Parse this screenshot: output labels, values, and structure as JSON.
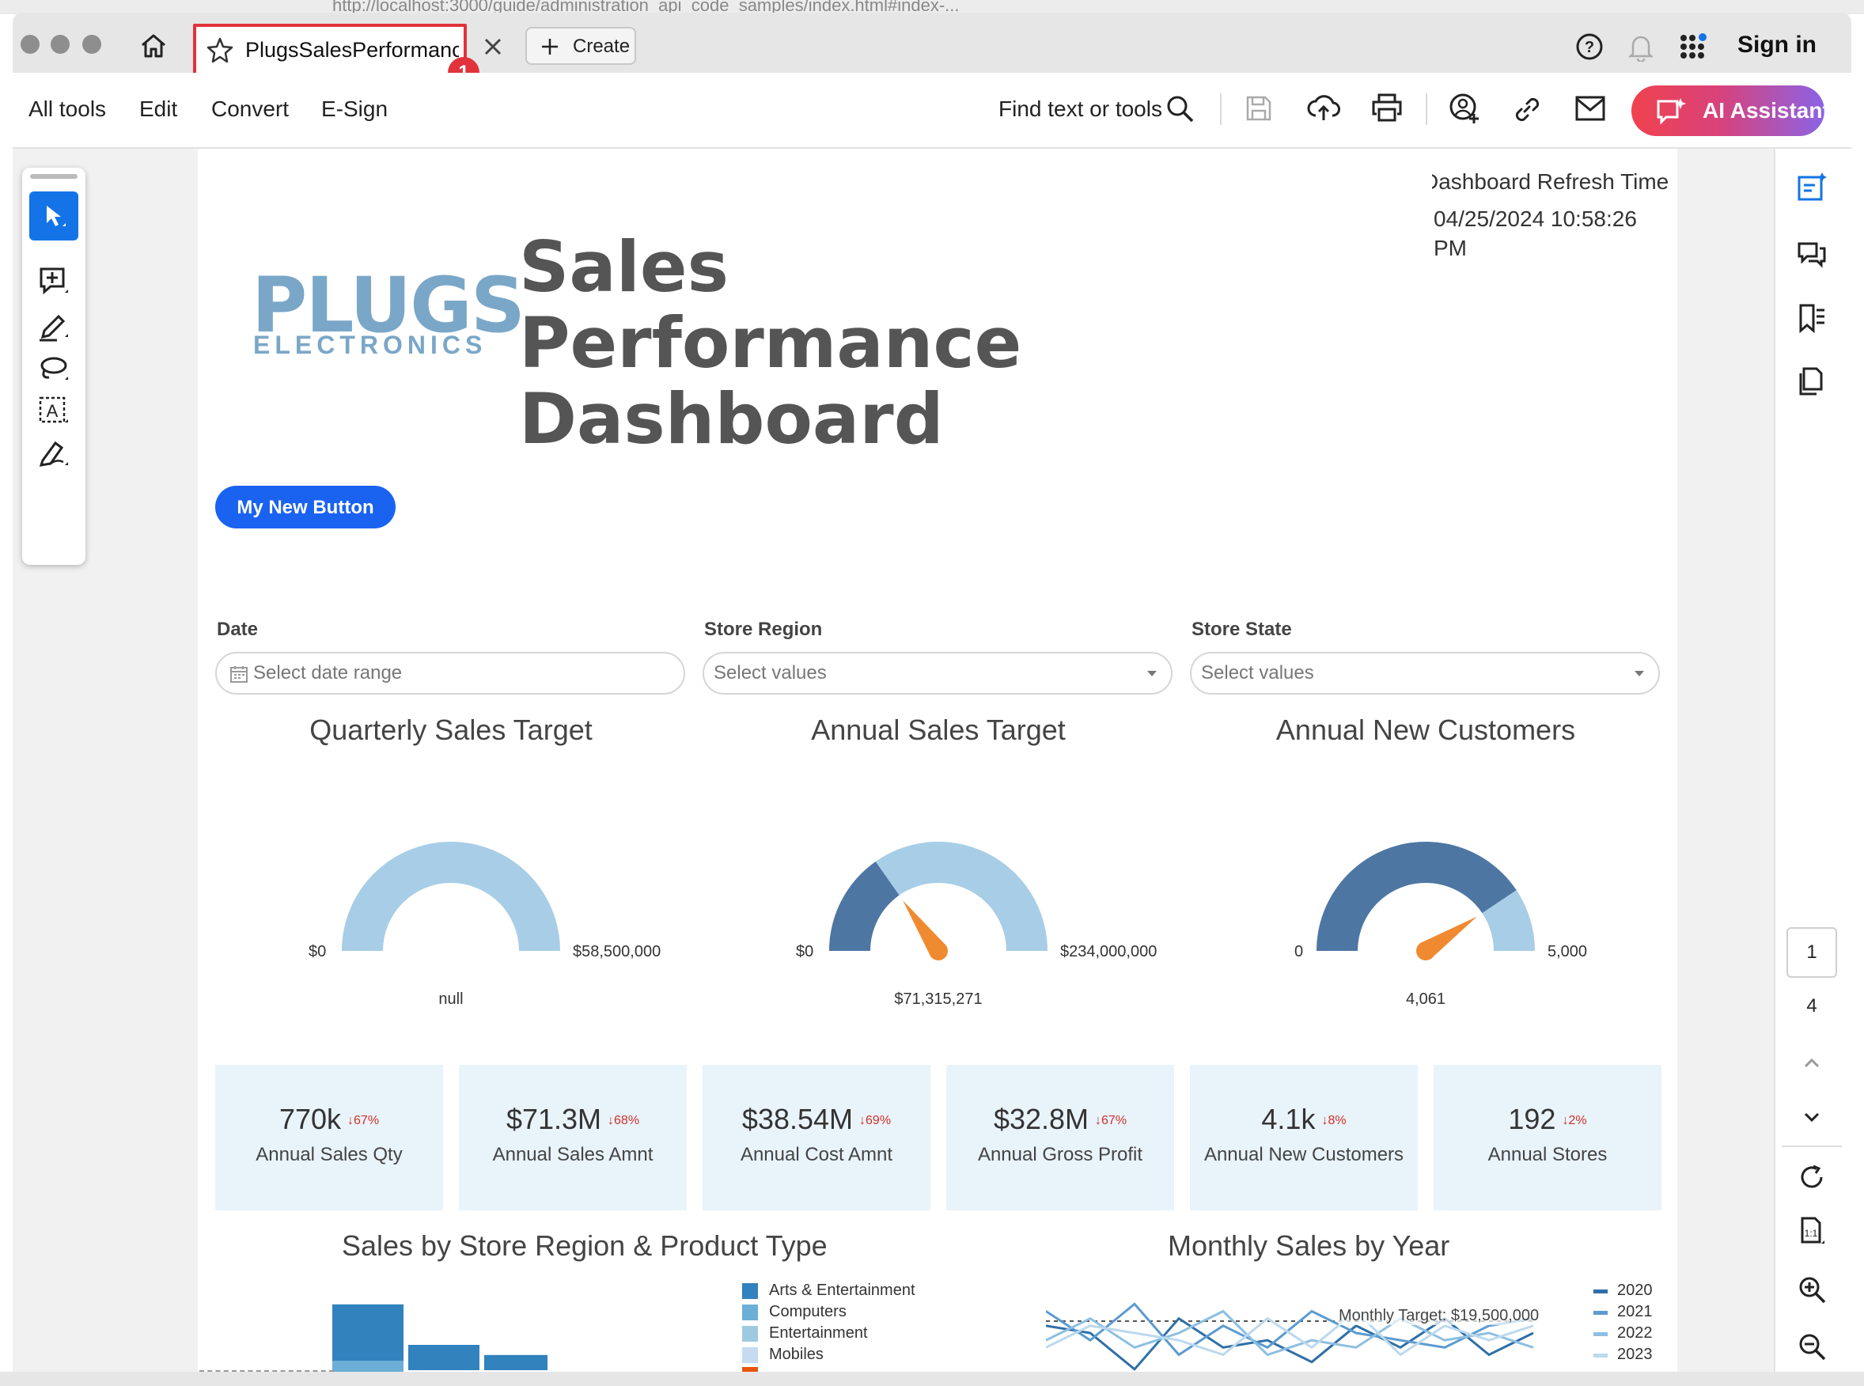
{
  "browser": {
    "url": "http://localhost:3000/guide/administration_api_code_samples/index.html#index-...",
    "tab_title": "PlugsSalesPerformanc...",
    "tab_badge": "1",
    "create_label": "Create",
    "sign_in": "Sign in"
  },
  "toolbar": {
    "menu": [
      "All tools",
      "Edit",
      "Convert",
      "E-Sign"
    ],
    "find_placeholder": "Find text or tools",
    "ai_assistant": "AI Assistant"
  },
  "dashboard": {
    "refresh_label": "Dashboard Refresh Time",
    "refresh_time": "04/25/2024 10:58:26 PM",
    "logo_main": "PLUGS",
    "logo_sub": "ELECTRONICS",
    "title": "Sales Performance Dashboard",
    "button_label": "My New Button",
    "filters": [
      {
        "label": "Date",
        "placeholder": "Select date range"
      },
      {
        "label": "Store Region",
        "placeholder": "Select values"
      },
      {
        "label": "Store State",
        "placeholder": "Select values"
      }
    ],
    "gauges": [
      {
        "title": "Quarterly Sales Target",
        "min_label": "$0",
        "max_label": "$58,500,000",
        "value_label": "null",
        "fraction": 0
      },
      {
        "title": "Annual Sales Target",
        "min_label": "$0",
        "max_label": "$234,000,000",
        "value_label": "$71,315,271",
        "fraction": 0.305
      },
      {
        "title": "Annual New Customers",
        "min_label": "0",
        "max_label": "5,000",
        "value_label": "4,061",
        "fraction": 0.812
      }
    ],
    "kpis": [
      {
        "value": "770k",
        "change": "↓67%",
        "label": "Annual Sales Qty"
      },
      {
        "value": "$71.3M",
        "change": "↓68%",
        "label": "Annual Sales Amnt"
      },
      {
        "value": "$38.54M",
        "change": "↓69%",
        "label": "Annual Cost Amnt"
      },
      {
        "value": "$32.8M",
        "change": "↓67%",
        "label": "Annual Gross Profit"
      },
      {
        "value": "4.1k",
        "change": "↓8%",
        "label": "Annual New Customers"
      },
      {
        "value": "192",
        "change": "↓2%",
        "label": "Annual Stores"
      }
    ],
    "bar_section_title": "Sales by Store Region & Product Type",
    "bar_legend": [
      "Arts & Entertainment",
      "Computers",
      "Entertainment",
      "Mobiles"
    ],
    "line_section_title": "Monthly Sales by Year",
    "line_target_label": "Monthly Target: $19,500,000",
    "line_legend": [
      "2020",
      "2021",
      "2022",
      "2023"
    ]
  },
  "pager": {
    "current": "1",
    "total": "4"
  },
  "colors": {
    "accent_blue": "#1473e6",
    "gauge_light": "#a8cde6",
    "gauge_dark": "#4e76a3",
    "needle": "#f08a30",
    "kpi_bg": "#e9f3fa",
    "down_red": "#d0302a",
    "tab_highlight": "#e0333b"
  },
  "icons": [
    "home-icon",
    "star-icon",
    "close-icon",
    "plus-icon",
    "help-icon",
    "bell-icon",
    "apps-grid-icon",
    "search-icon",
    "save-icon",
    "upload-cloud-icon",
    "print-icon",
    "share-user-icon",
    "link-icon",
    "mail-icon",
    "select-arrow-icon",
    "comment-add-icon",
    "highlight-pen-icon",
    "lasso-icon",
    "text-select-icon",
    "sign-pen-icon",
    "edit-panel-icon",
    "comments-icon",
    "bookmarks-icon",
    "pages-icon",
    "refresh-icon",
    "fit-page-icon",
    "zoom-in-icon",
    "zoom-out-icon",
    "chevron-up-icon",
    "chevron-down-icon",
    "calendar-icon"
  ],
  "chart_data": [
    {
      "type": "bar",
      "title": "Sales by Store Region & Product Type",
      "legend": [
        "Arts & Entertainment",
        "Computers",
        "Entertainment",
        "Mobiles"
      ],
      "series": [
        {
          "name": "Arts & Entertainment",
          "values": [
            52,
            20,
            12
          ]
        }
      ],
      "visible_partially": true
    },
    {
      "type": "line",
      "title": "Monthly Sales by Year",
      "annotation": "Monthly Target: $19,500,000",
      "legend": [
        "2020",
        "2021",
        "2022",
        "2023"
      ],
      "series": [
        {
          "name": "2020",
          "values": [
            15,
            14,
            9,
            16,
            12,
            13,
            10,
            15,
            12,
            16,
            11,
            14
          ]
        },
        {
          "name": "2021",
          "values": [
            17,
            13,
            18,
            11,
            15,
            12,
            17,
            14,
            13,
            12,
            15,
            16
          ]
        },
        {
          "name": "2022",
          "values": [
            13,
            16,
            12,
            14,
            17,
            11,
            13,
            12,
            16,
            13,
            14,
            12
          ]
        },
        {
          "name": "2023",
          "values": [
            12,
            15,
            14,
            13,
            11,
            16,
            12,
            17,
            11,
            15,
            13,
            15
          ]
        }
      ],
      "visible_partially": true
    }
  ]
}
